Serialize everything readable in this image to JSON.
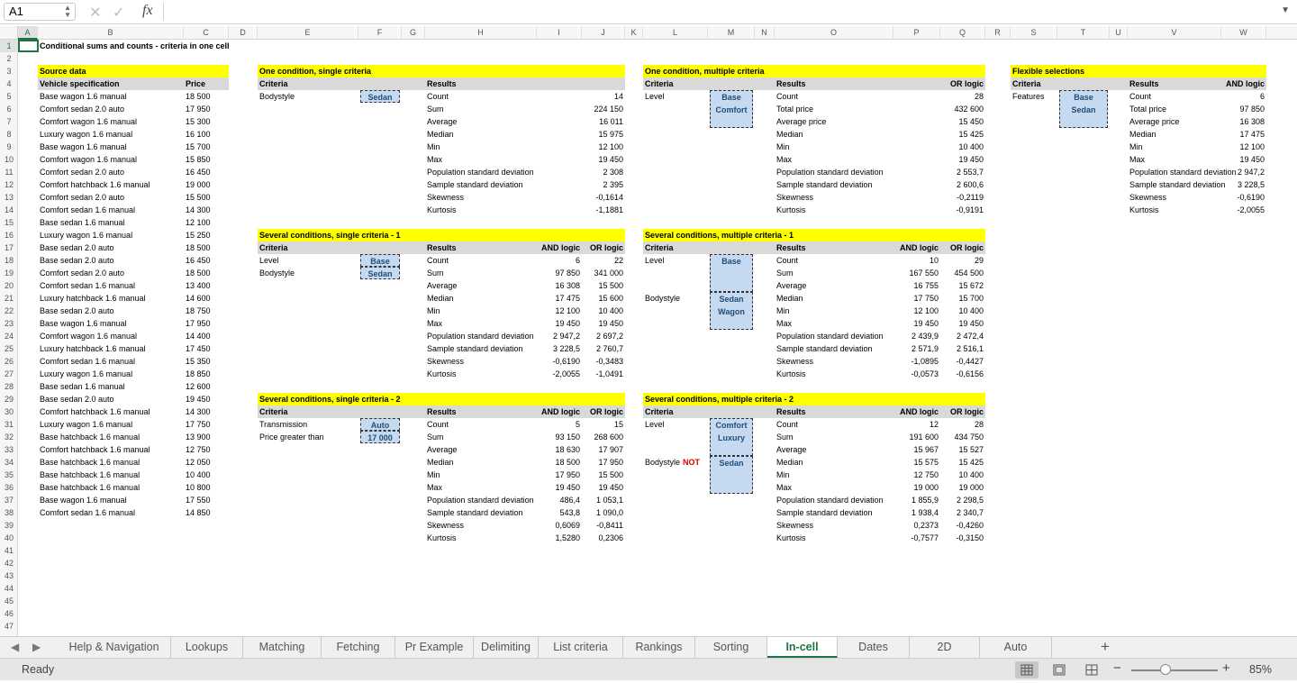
{
  "formula_bar": {
    "name_box": "A1",
    "formula": ""
  },
  "columns": [
    "A",
    "B",
    "C",
    "D",
    "E",
    "F",
    "G",
    "H",
    "I",
    "J",
    "K",
    "L",
    "M",
    "N",
    "O",
    "P",
    "Q",
    "R",
    "S",
    "T",
    "U",
    "V",
    "W"
  ],
  "rows": [
    "1",
    "2",
    "3",
    "4",
    "5",
    "6",
    "7",
    "8",
    "9",
    "10",
    "11",
    "12",
    "13",
    "14",
    "15",
    "16",
    "17",
    "18",
    "19",
    "20",
    "21",
    "22",
    "23",
    "24",
    "25",
    "26",
    "27",
    "28",
    "29",
    "30",
    "31",
    "32",
    "33",
    "34",
    "35",
    "36",
    "37",
    "38",
    "39",
    "40",
    "41",
    "42",
    "43",
    "44",
    "45",
    "46",
    "47"
  ],
  "sheet": {
    "title": "Conditional sums and counts - criteria in one cell",
    "source": {
      "title": "Source data",
      "headers": [
        "Vehicle specification",
        "Price"
      ],
      "rows": [
        [
          "Base wagon 1.6 manual",
          "18 500"
        ],
        [
          "Comfort sedan 2.0 auto",
          "17 950"
        ],
        [
          "Comfort wagon 1.6 manual",
          "15 300"
        ],
        [
          "Luxury wagon 1.6 manual",
          "16 100"
        ],
        [
          "Base wagon 1.6 manual",
          "15 700"
        ],
        [
          "Comfort wagon 1.6 manual",
          "15 850"
        ],
        [
          "Comfort sedan 2.0 auto",
          "16 450"
        ],
        [
          "Comfort hatchback 1.6 manual",
          "19 000"
        ],
        [
          "Comfort sedan 2.0 auto",
          "15 500"
        ],
        [
          "Comfort sedan 1.6 manual",
          "14 300"
        ],
        [
          "Base sedan 1.6 manual",
          "12 100"
        ],
        [
          "Luxury wagon 1.6 manual",
          "15 250"
        ],
        [
          "Base sedan 2.0 auto",
          "18 500"
        ],
        [
          "Base sedan 2.0 auto",
          "16 450"
        ],
        [
          "Comfort sedan 2.0 auto",
          "18 500"
        ],
        [
          "Comfort sedan 1.6 manual",
          "13 400"
        ],
        [
          "Luxury hatchback 1.6 manual",
          "14 600"
        ],
        [
          "Base sedan 2.0 auto",
          "18 750"
        ],
        [
          "Base wagon 1.6 manual",
          "17 950"
        ],
        [
          "Comfort wagon 1.6 manual",
          "14 400"
        ],
        [
          "Luxury hatchback 1.6 manual",
          "17 450"
        ],
        [
          "Comfort sedan 1.6 manual",
          "15 350"
        ],
        [
          "Luxury wagon 1.6 manual",
          "18 850"
        ],
        [
          "Base sedan 1.6 manual",
          "12 600"
        ],
        [
          "Base sedan 2.0 auto",
          "19 450"
        ],
        [
          "Comfort hatchback 1.6 manual",
          "14 300"
        ],
        [
          "Luxury wagon 1.6 manual",
          "17 750"
        ],
        [
          "Base hatchback 1.6 manual",
          "13 900"
        ],
        [
          "Comfort hatchback 1.6 manual",
          "12 750"
        ],
        [
          "Base hatchback 1.6 manual",
          "12 050"
        ],
        [
          "Base hatchback 1.6 manual",
          "10 400"
        ],
        [
          "Base hatchback 1.6 manual",
          "10 800"
        ],
        [
          "Base wagon 1.6 manual",
          "17 550"
        ],
        [
          "Comfort sedan 1.6 manual",
          "14 850"
        ]
      ]
    },
    "stat_labels": [
      "Count",
      "Sum",
      "Average",
      "Median",
      "Min",
      "Max",
      "Population standard deviation",
      "Sample standard deviation",
      "Skewness",
      "Kurtosis"
    ],
    "stat_labels_price": [
      "Count",
      "Total price",
      "Average price",
      "Median",
      "Min",
      "Max",
      "Population standard deviation",
      "Sample standard deviation",
      "Skewness",
      "Kurtosis"
    ],
    "labels": {
      "criteria": "Criteria",
      "results": "Results",
      "and_logic": "AND logic",
      "or_logic": "OR logic",
      "not": "NOT"
    },
    "s1": {
      "title": "One condition, single criteria",
      "crit_label": "Bodystyle",
      "crit": "Sedan",
      "values": [
        "14",
        "224 150",
        "16 011",
        "15 975",
        "12 100",
        "19 450",
        "2 308",
        "2 395",
        "-0,1614",
        "-1,1881"
      ]
    },
    "s2": {
      "title": "One condition, multiple criteria",
      "crit_label": "Level",
      "crit": [
        "Base",
        "Comfort"
      ],
      "values": [
        "28",
        "432 600",
        "15 450",
        "15 425",
        "10 400",
        "19 450",
        "2 553,7",
        "2 600,6",
        "-0,2119",
        "-0,9191"
      ]
    },
    "s3": {
      "title": "Flexible selections",
      "crit_label": "Features",
      "crit": [
        "Base",
        "Sedan"
      ],
      "values": [
        "6",
        "97 850",
        "16 308",
        "17 475",
        "12 100",
        "19 450",
        "2 947,2",
        "3 228,5",
        "-0,6190",
        "-2,0055"
      ]
    },
    "s4": {
      "title": "Several conditions, single criteria - 1",
      "crit_labels": [
        "Level",
        "Bodystyle"
      ],
      "crit": [
        "Base",
        "Sedan"
      ],
      "and": [
        "6",
        "97 850",
        "16 308",
        "17 475",
        "12 100",
        "19 450",
        "2 947,2",
        "3 228,5",
        "-0,6190",
        "-2,0055"
      ],
      "or": [
        "22",
        "341 000",
        "15 500",
        "15 600",
        "10 400",
        "19 450",
        "2 697,2",
        "2 760,7",
        "-0,3483",
        "-1,0491"
      ]
    },
    "s5": {
      "title": "Several conditions, multiple criteria - 1",
      "crit_labels": [
        "Level",
        "Bodystyle"
      ],
      "crit1": "Base",
      "crit2": [
        "Sedan",
        "Wagon"
      ],
      "and": [
        "10",
        "167 550",
        "16 755",
        "17 750",
        "12 100",
        "19 450",
        "2 439,9",
        "2 571,9",
        "-1,0895",
        "-0,0573"
      ],
      "or": [
        "29",
        "454 500",
        "15 672",
        "15 700",
        "10 400",
        "19 450",
        "2 472,4",
        "2 516,1",
        "-0,4427",
        "-0,6156"
      ]
    },
    "s6": {
      "title": "Several conditions, single criteria - 2",
      "crit_labels": [
        "Transmission",
        "Price greater than"
      ],
      "crit": [
        "Auto",
        "17 000"
      ],
      "and": [
        "5",
        "93 150",
        "18 630",
        "18 500",
        "17 950",
        "19 450",
        "486,4",
        "543,8",
        "0,6069",
        "1,5280"
      ],
      "or": [
        "15",
        "268 600",
        "17 907",
        "17 950",
        "15 500",
        "19 450",
        "1 053,1",
        "1 090,0",
        "-0,8411",
        "0,2306"
      ]
    },
    "s7": {
      "title": "Several conditions, multiple criteria - 2",
      "crit_labels": [
        "Level",
        "Bodystyle"
      ],
      "crit1": [
        "Comfort",
        "Luxury"
      ],
      "crit2": "Sedan",
      "and": [
        "12",
        "191 600",
        "15 967",
        "15 575",
        "12 750",
        "19 000",
        "1 855,9",
        "1 938,4",
        "0,2373",
        "-0,7577"
      ],
      "or": [
        "28",
        "434 750",
        "15 527",
        "15 425",
        "10 400",
        "19 000",
        "2 298,5",
        "2 340,7",
        "-0,4260",
        "-0,3150"
      ]
    }
  },
  "tabs": [
    "Help & Navigation",
    "Lookups",
    "Matching",
    "Fetching",
    "Pr Example",
    "Delimiting",
    "List criteria",
    "Rankings",
    "Sorting",
    "In-cell",
    "Dates",
    "2D",
    "Auto"
  ],
  "active_tab": "In-cell",
  "status": {
    "ready": "Ready",
    "zoom": "85%"
  }
}
